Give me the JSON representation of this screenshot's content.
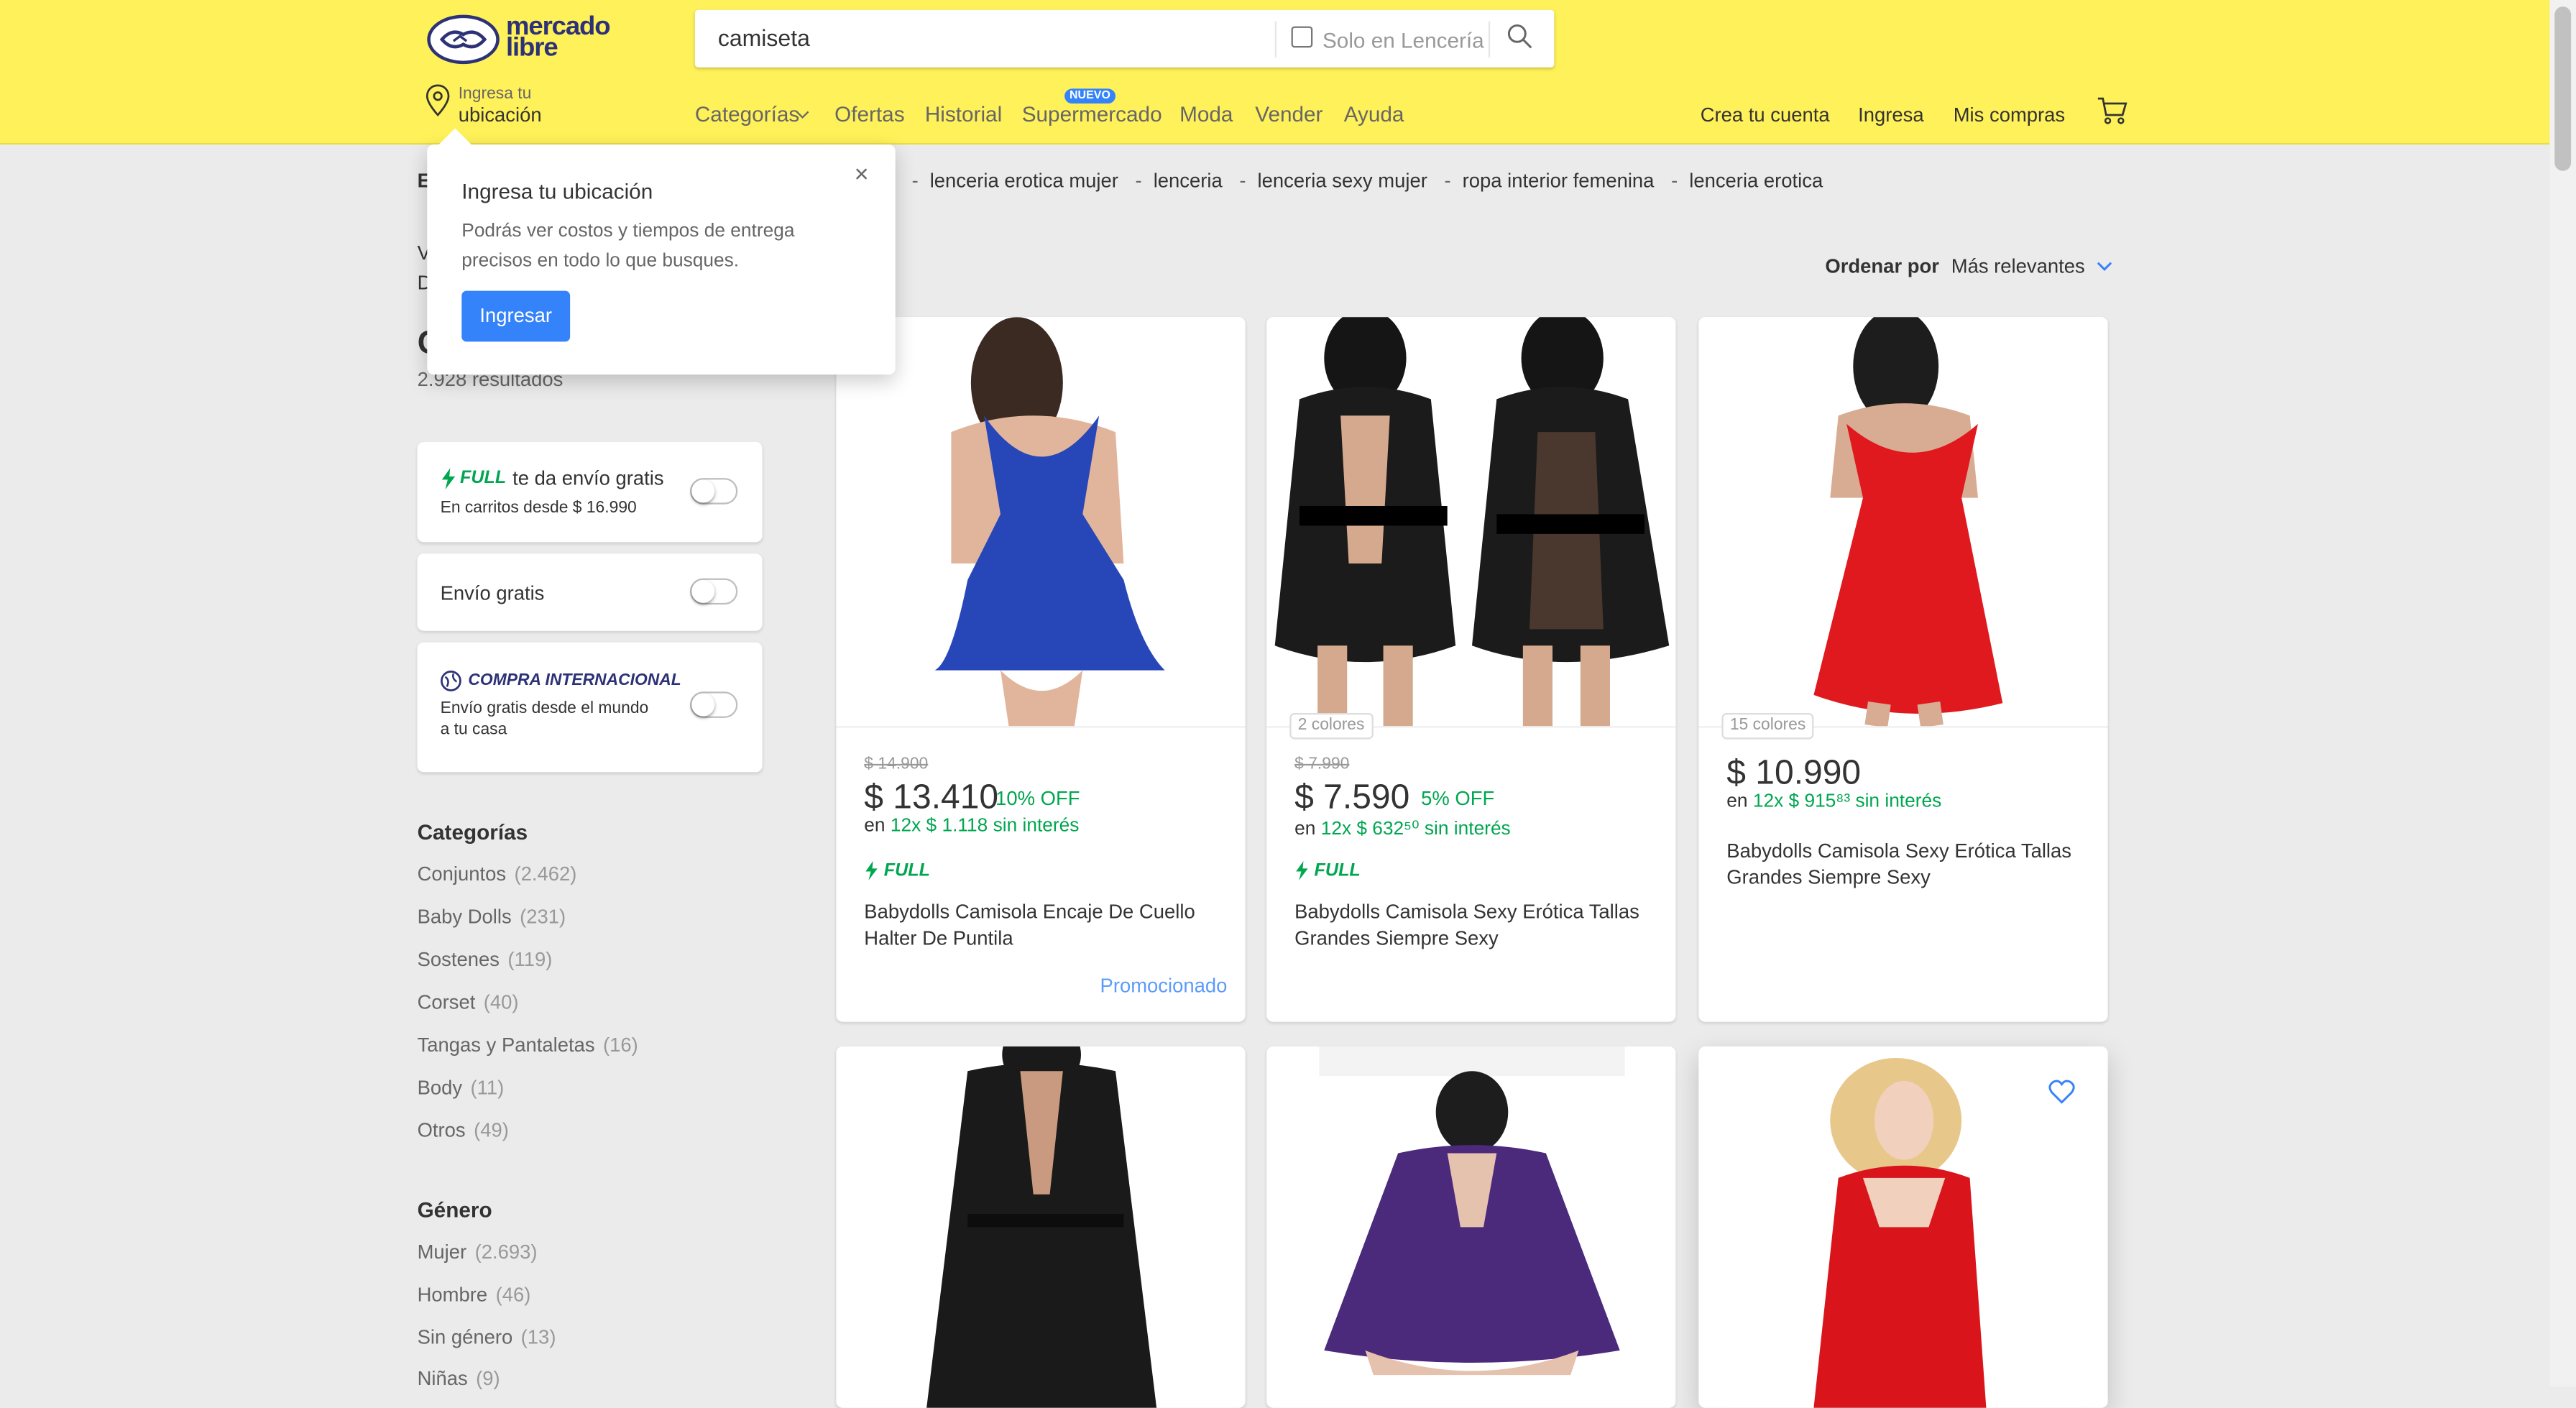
{
  "header": {
    "logo_line1": "mercado",
    "logo_line2": "libre",
    "search_value": "camiseta",
    "search_filter_label": "Solo en Lencería",
    "location_small": "Ingresa tu",
    "location_big": "ubicación",
    "nav": [
      "Categorías",
      "Ofertas",
      "Historial",
      "Supermercado",
      "Moda",
      "Vender",
      "Ayuda"
    ],
    "nuevo_badge": "NUEVO",
    "account_links": [
      "Crea tu cuenta",
      "Ingresa",
      "Mis compras"
    ]
  },
  "related_searches": [
    "lenceria erotica mujer",
    "lenceria",
    "lenceria sexy mujer",
    "ropa interior femenina",
    "lenceria erotica"
  ],
  "sort": {
    "label": "Ordenar por",
    "value": "Más relevantes"
  },
  "sidebar": {
    "fragments": [
      "E",
      "V",
      "D",
      "C"
    ],
    "results": "2.928 resultados",
    "full_filter": {
      "badge": "FULL",
      "title": "te da envío gratis",
      "subtitle": "En carritos desde $ 16.990"
    },
    "free_shipping_label": "Envío gratis",
    "international": {
      "badge": "COMPRA INTERNACIONAL",
      "subtitle_line1": "Envío gratis desde el mundo",
      "subtitle_line2": "a tu casa"
    },
    "categories_title": "Categorías",
    "categories": [
      {
        "name": "Conjuntos",
        "count": "(2.462)"
      },
      {
        "name": "Baby Dolls",
        "count": "(231)"
      },
      {
        "name": "Sostenes",
        "count": "(119)"
      },
      {
        "name": "Corset",
        "count": "(40)"
      },
      {
        "name": "Tangas y Pantaletas",
        "count": "(16)"
      },
      {
        "name": "Body",
        "count": "(11)"
      },
      {
        "name": "Otros",
        "count": "(49)"
      }
    ],
    "gender_title": "Género",
    "genders": [
      {
        "name": "Mujer",
        "count": "(2.693)"
      },
      {
        "name": "Hombre",
        "count": "(46)"
      },
      {
        "name": "Sin género",
        "count": "(13)"
      },
      {
        "name": "Niñas",
        "count": "(9)"
      }
    ]
  },
  "popup": {
    "title": "Ingresa tu ubicación",
    "description": "Podrás ver costos y tiempos de entrega precisos en todo lo que busques.",
    "button": "Ingresar",
    "close": "×"
  },
  "products": [
    {
      "old_price": "$ 14.900",
      "price": "$ 13.410",
      "discount": "10% OFF",
      "inst_prefix": "en",
      "installments": "12x $ 1.118 sin interés",
      "full": "FULL",
      "title": "Babydolls Camisola Encaje De Cuello Halter De Puntila",
      "promoted": "Promocionado",
      "color": "#2747b8"
    },
    {
      "old_price": "$ 7.990",
      "price": "$ 7.590",
      "discount": "5% OFF",
      "inst_prefix": "en",
      "installments": "12x $ 632⁵⁰ sin interés",
      "full": "FULL",
      "title": "Babydolls Camisola Sexy Erótica Tallas Grandes Siempre Sexy",
      "colors": "2 colores",
      "color": "#1b1b1b"
    },
    {
      "price": "$ 10.990",
      "inst_prefix": "en",
      "installments": "12x $ 915⁸³ sin interés",
      "title": "Babydolls Camisola Sexy Erótica Tallas Grandes Siempre Sexy",
      "colors": "15 colores",
      "color": "#e0191e"
    },
    {
      "color": "#1a1a1a"
    },
    {
      "color": "#4b2a7c"
    },
    {
      "color": "#d9151b"
    }
  ],
  "colors": {
    "brand_yellow": "#fff159",
    "accent_blue": "#3483fa",
    "green": "#00a650"
  }
}
